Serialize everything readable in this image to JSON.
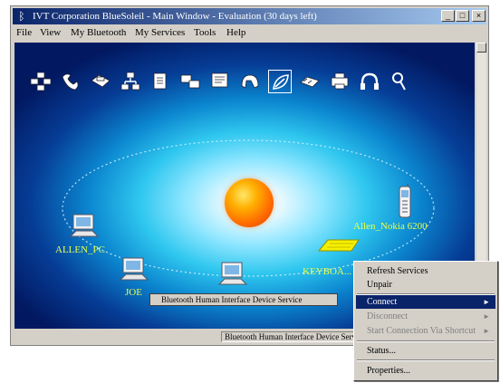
{
  "window": {
    "title": "IVT Corporation BlueSoleil - Main Window - Evaluation (30 days left)",
    "minimize_label": "_",
    "maximize_label": "□",
    "close_label": "×"
  },
  "menu": {
    "items": [
      {
        "label": "File"
      },
      {
        "label": "View"
      },
      {
        "label": "My Bluetooth"
      },
      {
        "label": "My Services"
      },
      {
        "label": "Tools"
      },
      {
        "label": "Help"
      }
    ]
  },
  "toolbar": {
    "icons": [
      "personal-area-network-icon",
      "dialup-networking-icon",
      "fax-icon",
      "lan-access-icon",
      "file-transfer-icon",
      "serial-port-icon",
      "object-push-icon",
      "headset-icon",
      "human-interface-device-icon",
      "synchronization-icon",
      "printer-icon",
      "audio-gateway-icon",
      "search-icon"
    ]
  },
  "devices": [
    {
      "name": "ALLEN_PC",
      "icon": "computer-icon"
    },
    {
      "name": "JOE",
      "icon": "computer-icon"
    },
    {
      "name": "",
      "icon": "computer-icon"
    },
    {
      "name": "KEYBOA...",
      "icon": "keyboard-icon"
    },
    {
      "name": "Allen_Nokia 6200",
      "icon": "mobile-phone-icon"
    }
  ],
  "tooltip": {
    "text": "Bluetooth Human Interface Device Service"
  },
  "status": {
    "text": "Bluetooth Human Interface Device Service"
  },
  "context_menu": {
    "items": [
      {
        "label": "Refresh Services",
        "state": "normal"
      },
      {
        "label": "Unpair",
        "state": "normal"
      },
      {
        "label": "Connect",
        "state": "highlighted",
        "submenu": true
      },
      {
        "label": "Disconnect",
        "state": "disabled",
        "submenu": true
      },
      {
        "label": "Start Connection Via Shortcut",
        "state": "disabled",
        "submenu": true
      },
      {
        "label": "Status...",
        "state": "normal"
      },
      {
        "label": "Properties...",
        "state": "normal"
      }
    ],
    "submenu_arrow": "►"
  },
  "colors": {
    "title_gradient_start": "#0a246a",
    "highlight": "#0a246a",
    "device_label": "#e6ff4a",
    "sun": "#ff6a00"
  }
}
